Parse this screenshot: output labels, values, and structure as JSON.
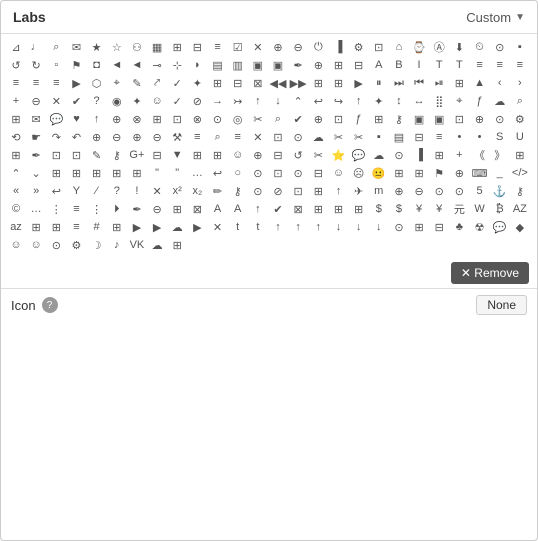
{
  "header": {
    "title": "Labs",
    "custom_label": "Custom",
    "dropdown_arrow": "▼"
  },
  "footer": {
    "icon_label": "Icon",
    "help_symbol": "?",
    "none_button": "None",
    "remove_button": "✕ Remove"
  },
  "icons": [
    "⊞",
    "♩",
    "🔍",
    "✉",
    "★",
    "☆",
    "👤",
    "🎬",
    "⊟",
    "⊞",
    "≡",
    "☑",
    "✕",
    "🔍",
    "🔎",
    "⏻",
    "📶",
    "⚙",
    "🗑",
    "🏠",
    "🕐",
    "Ⓐ",
    "⬇",
    "🕐",
    "◎",
    "📷",
    "↺",
    "↻",
    "📄",
    "🔒",
    "🚩",
    "🎧",
    "◀",
    "◀",
    "🔇",
    "≡",
    "≡",
    "🏷",
    "🏷",
    "✒",
    "🔖",
    "🖨",
    "📷",
    "A",
    "B",
    "I",
    "T",
    "T",
    "≡",
    "≡",
    "≡",
    "≡",
    "≡",
    "≡",
    "≡",
    "▶",
    "🎬",
    "📍",
    "✏",
    "↗",
    "✓",
    "✦",
    "⊞",
    "⊟",
    "⊠",
    "◀",
    "⊞",
    "⊞",
    "⊞",
    "▶",
    "⏸",
    "▶",
    "▶",
    "⊞",
    "⊞",
    "▲",
    "‹",
    "›",
    "✚",
    "⊖",
    "✕",
    "✔",
    "?",
    "👁",
    "✦",
    "☺",
    "✓",
    "⊘",
    "→",
    "→",
    "↑",
    "↓",
    "∧",
    "↩",
    "↪",
    "✂",
    "📁",
    "↕",
    "↔",
    "📊",
    "🐦",
    "f",
    "☁",
    "🔎",
    "📅",
    "✉",
    "💬",
    "❤",
    "↑",
    "👍",
    "🔗",
    "in",
    "📌",
    "↗",
    "🏆",
    "◎",
    "✂",
    "📞",
    "✔",
    "🔖",
    "🐦",
    "f",
    "⊞",
    "🔒",
    "💳",
    "💳",
    "🗂",
    "📢",
    "🔔",
    "⚙",
    "⟲",
    "✋",
    "↷",
    "↶",
    "⊕",
    "⊖",
    "⊕",
    "⊖",
    "🔧",
    "≡",
    "🔍",
    "🏷",
    "✕",
    "👥",
    "🌐",
    "☁",
    "✂",
    "✂",
    "🏷",
    "💾",
    "⊟",
    "≡",
    "≡",
    "≡",
    "S",
    "U",
    "⊞",
    "✒",
    "🚚",
    "📌",
    "✎",
    "🔑",
    "g+",
    "⊟",
    "▼",
    "⊞",
    "⊞",
    "👤",
    "🏥",
    "⊕",
    "in",
    "↺",
    "✂",
    "⭐",
    "💬",
    "⊕",
    "☁",
    "📶",
    "🏠",
    "⊞",
    "✚",
    "《",
    "》",
    "⊞",
    "∧",
    "∨",
    "⊞",
    "🖥",
    "💻",
    "📱",
    "📱",
    "❝",
    "❞",
    "⋯",
    "↩",
    "◎",
    "🐱",
    "📁",
    "📂",
    "⊟",
    "☺",
    "☹",
    "😐",
    "⊞",
    "⊞",
    "🚩",
    "🔖",
    "⌨",
    "_",
    "</>",
    "«",
    "»",
    "↩",
    "⊞",
    "Y",
    "⁄",
    "?",
    "!",
    "✕",
    "x²",
    "x₂",
    "✏",
    "🔒",
    "🎤",
    "⊘",
    "🛡",
    "📅",
    "↑",
    "✈",
    "m",
    "⊕",
    "⊖",
    "⊙",
    "⊙",
    "⊞",
    "⚓",
    "🔒",
    "©",
    "⋯",
    "⋮",
    "≡",
    "⋮",
    "⏵",
    "✒",
    "⊖",
    "⊞",
    "⊠",
    "A",
    "A",
    "↑",
    "✔",
    "⊠",
    "⊞",
    "⊞",
    "⊞",
    "⊞",
    "💲",
    "$",
    "¥",
    "¥",
    "元",
    "W",
    "₿",
    "A-Z",
    "A-Z",
    "⊞",
    "⊞",
    "≡",
    "🔢",
    "1-9",
    "⊞",
    "▶",
    "▶",
    "☁",
    "▶",
    "✕",
    "t",
    "t",
    "↑",
    "↑",
    "↑",
    "↓",
    "↓",
    "↓",
    "🍎",
    "⊞",
    "🐧",
    "♣",
    "☢",
    "💬",
    "♦",
    "👤",
    "👤",
    "⊙",
    "⚙",
    "☽",
    "🎵",
    "VK",
    "☁",
    "⊞"
  ],
  "accent_color": "#555555",
  "remove_area_visible": true
}
